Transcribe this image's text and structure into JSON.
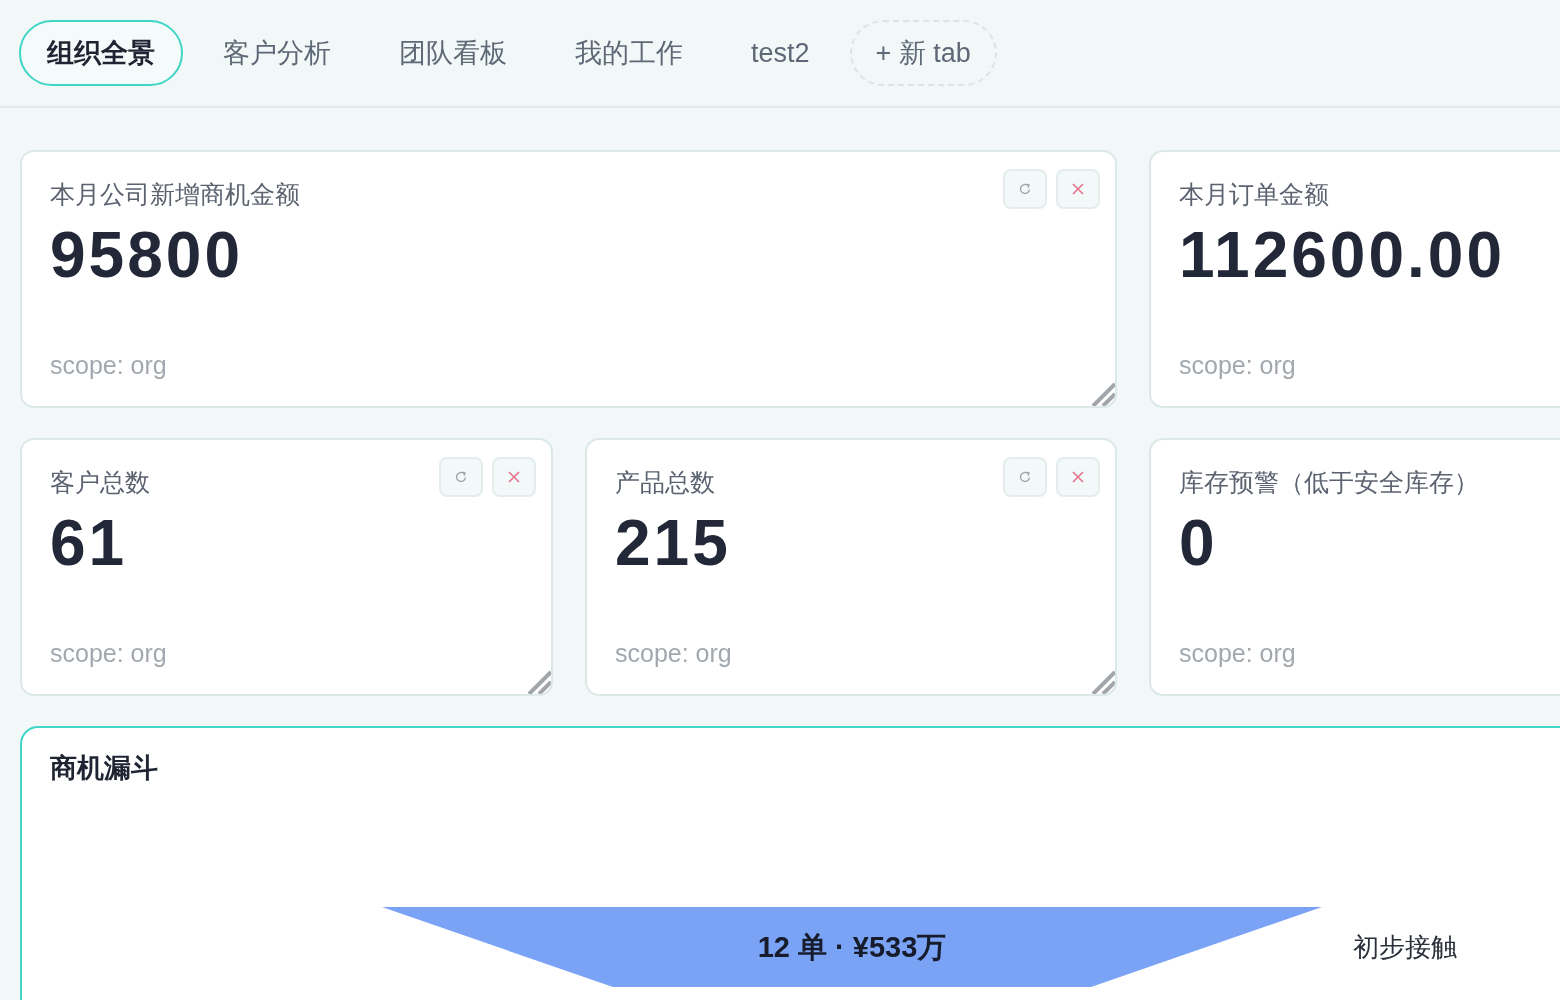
{
  "tabs": [
    {
      "label": "组织全景",
      "selected": true
    },
    {
      "label": "客户分析",
      "selected": false
    },
    {
      "label": "团队看板",
      "selected": false
    },
    {
      "label": "我的工作",
      "selected": false
    },
    {
      "label": "test2",
      "selected": false
    }
  ],
  "new_tab_button": {
    "label": "+ 新 tab"
  },
  "cards": [
    {
      "title": "本月公司新增商机金额",
      "value": "95800",
      "scope": "scope: org",
      "actions": [
        {
          "kind": "refresh"
        },
        {
          "kind": "close"
        }
      ],
      "resizable": true
    },
    {
      "title": "本月订单金额",
      "value": "112600.00",
      "scope": "scope: org"
    },
    {
      "title": "客户总数",
      "value": "61",
      "scope": "scope: org",
      "actions": [
        {
          "kind": "refresh"
        },
        {
          "kind": "close"
        }
      ],
      "resizable": true
    },
    {
      "title": "产品总数",
      "value": "215",
      "scope": "scope: org",
      "actions": [
        {
          "kind": "refresh"
        },
        {
          "kind": "close"
        }
      ],
      "resizable": true
    },
    {
      "title": "库存预警（低于安全库存）",
      "value": "0",
      "scope": "scope: org"
    }
  ],
  "funnel": {
    "title": "商机漏斗",
    "focused": true,
    "stages": [
      {
        "label": "初步接触",
        "summary": "12 单 · ¥533万",
        "color": "#7aa2f5"
      }
    ]
  }
}
